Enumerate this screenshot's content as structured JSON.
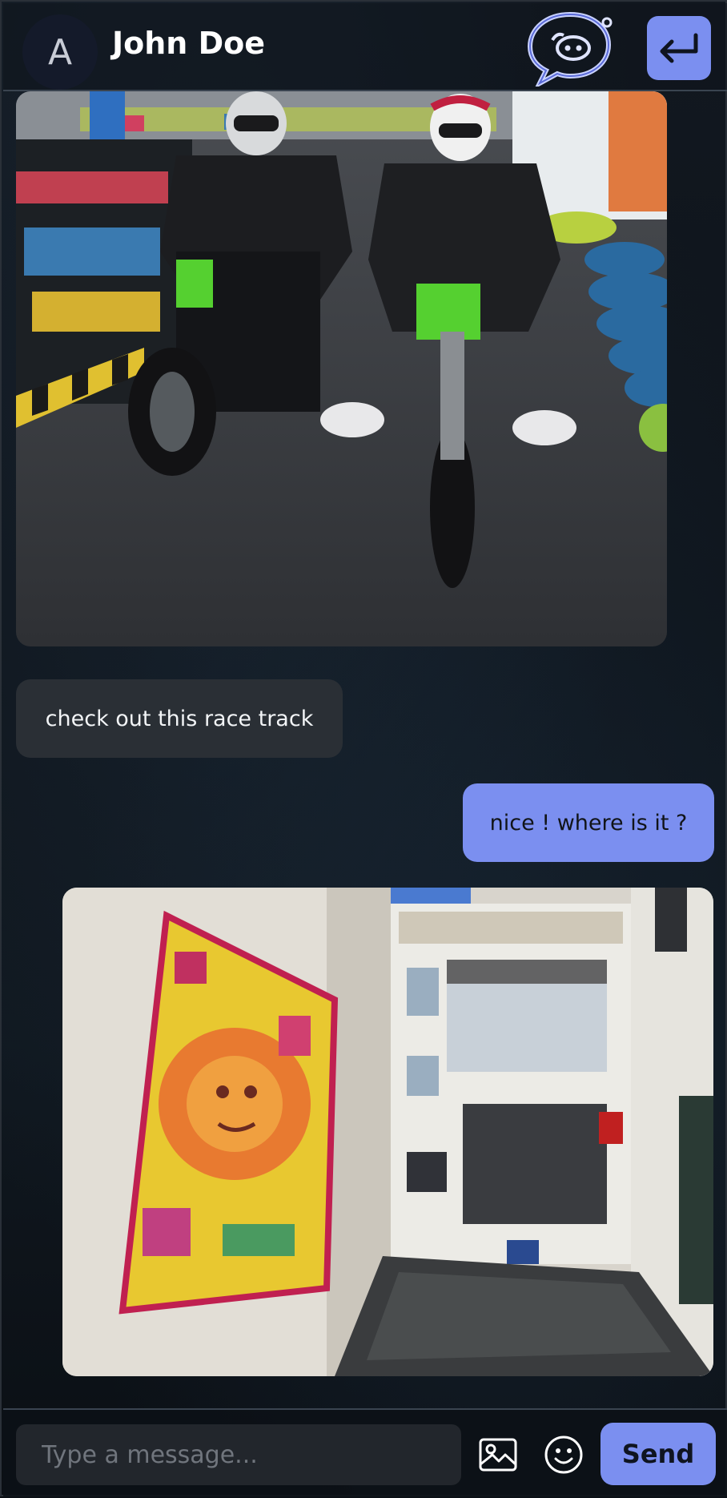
{
  "header": {
    "avatar_initial": "A",
    "contact_name": "John Doe"
  },
  "messages": [
    {
      "type": "image",
      "direction": "incoming",
      "description_icon": "photo"
    },
    {
      "type": "text",
      "direction": "incoming",
      "text": "check out this race track"
    },
    {
      "type": "text",
      "direction": "outgoing",
      "text": "nice ! where is it ?"
    },
    {
      "type": "image",
      "direction": "outgoing",
      "description_icon": "photo"
    }
  ],
  "composer": {
    "placeholder": "Type a message...",
    "send_label": "Send"
  },
  "colors": {
    "accent": "#7b8ff0",
    "incoming_bubble": "#2a2f35",
    "background": "#0e141b"
  },
  "icons": [
    "chat-logo-icon",
    "back-arrow-icon",
    "image-icon",
    "emoji-icon"
  ]
}
